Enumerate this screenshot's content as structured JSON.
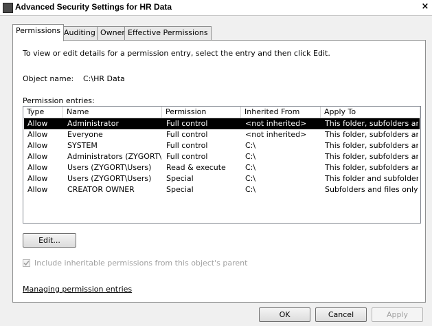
{
  "window": {
    "title": "Advanced Security Settings for HR Data",
    "close_glyph": "×"
  },
  "tabs": [
    {
      "label": "Permissions"
    },
    {
      "label": "Auditing"
    },
    {
      "label": "Owner"
    },
    {
      "label": "Effective Permissions"
    }
  ],
  "permissions": {
    "instructions": "To view or edit details for a permission entry, select the entry and then click Edit.",
    "object_name_label": "Object name:",
    "object_name_value": "C:\\HR Data",
    "entries_label": "Permission entries:",
    "columns": [
      "Type",
      "Name",
      "Permission",
      "Inherited From",
      "Apply To"
    ],
    "rows": [
      [
        "Allow",
        "Administrator",
        "Full control",
        "<not inherited>",
        "This folder, subfolders and..."
      ],
      [
        "Allow",
        "Everyone",
        "Full control",
        "<not inherited>",
        "This folder, subfolders and..."
      ],
      [
        "Allow",
        "SYSTEM",
        "Full control",
        "C:\\",
        "This folder, subfolders and..."
      ],
      [
        "Allow",
        "Administrators (ZYGORT\\...",
        "Full control",
        "C:\\",
        "This folder, subfolders and..."
      ],
      [
        "Allow",
        "Users (ZYGORT\\Users)",
        "Read & execute",
        "C:\\",
        "This folder, subfolders and..."
      ],
      [
        "Allow",
        "Users (ZYGORT\\Users)",
        "Special",
        "C:\\",
        "This folder and subfolders"
      ],
      [
        "Allow",
        "CREATOR OWNER",
        "Special",
        "C:\\",
        "Subfolders and files only"
      ]
    ],
    "selected_row": 0,
    "edit_label": "Edit...",
    "include_inheritable_label": "Include inheritable permissions from this object's parent",
    "include_inheritable_checked": true,
    "managing_link": "Managing permission entries"
  },
  "footer": {
    "ok_label": "OK",
    "cancel_label": "Cancel",
    "apply_label": "Apply"
  }
}
